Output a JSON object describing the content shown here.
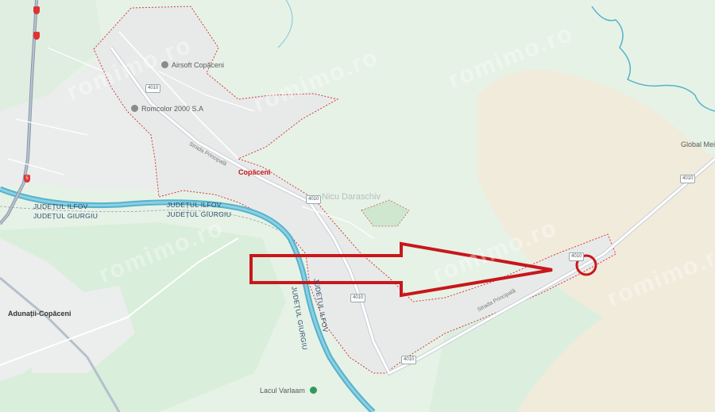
{
  "places": {
    "copaceni": "Copăceni",
    "adunatii": "Adunații-Copăceni",
    "global": "Global Mei"
  },
  "pois": {
    "airsoft": "Airsoft Copăceni",
    "romcolor": "Romcolor 2000 S.A",
    "lacul": "Lacul Varlaam"
  },
  "counties": {
    "ilfov_1": "JUDEȚUL ILFOV",
    "giurgiu_1": "JUDEȚUL GIURGIU",
    "ilfov_2": "JUDEȚUL ILFOV",
    "giurgiu_2": "JUDEȚUL GIURGIU",
    "ilfov_3": "JUDEȚUL ILFOV",
    "giurgiu_3": "JUDEȚUL GIURGIU"
  },
  "roads": {
    "strada_1": "Strada Principală",
    "strada_2": "Strada Principală",
    "shield_1": "4010",
    "shield_2": "4010",
    "shield_3": "4010",
    "shield_4": "4010",
    "shield_5": "4010",
    "shield_6": "4010",
    "national": "5"
  },
  "watermarks": [
    "romimo.ro",
    "romimo.ro",
    "romimo.ro",
    "romimo.ro",
    "romimo.ro",
    "romimo.ro"
  ],
  "faint_text": "Nicu Daraschiv",
  "colors": {
    "green": "#e8f3e8",
    "sand": "#f1ebdc",
    "river": "#56b2cc",
    "road": "#ffffff",
    "boundary": "#d23a3a",
    "arrow": "#c8171b",
    "locality": "#e9ebea"
  }
}
